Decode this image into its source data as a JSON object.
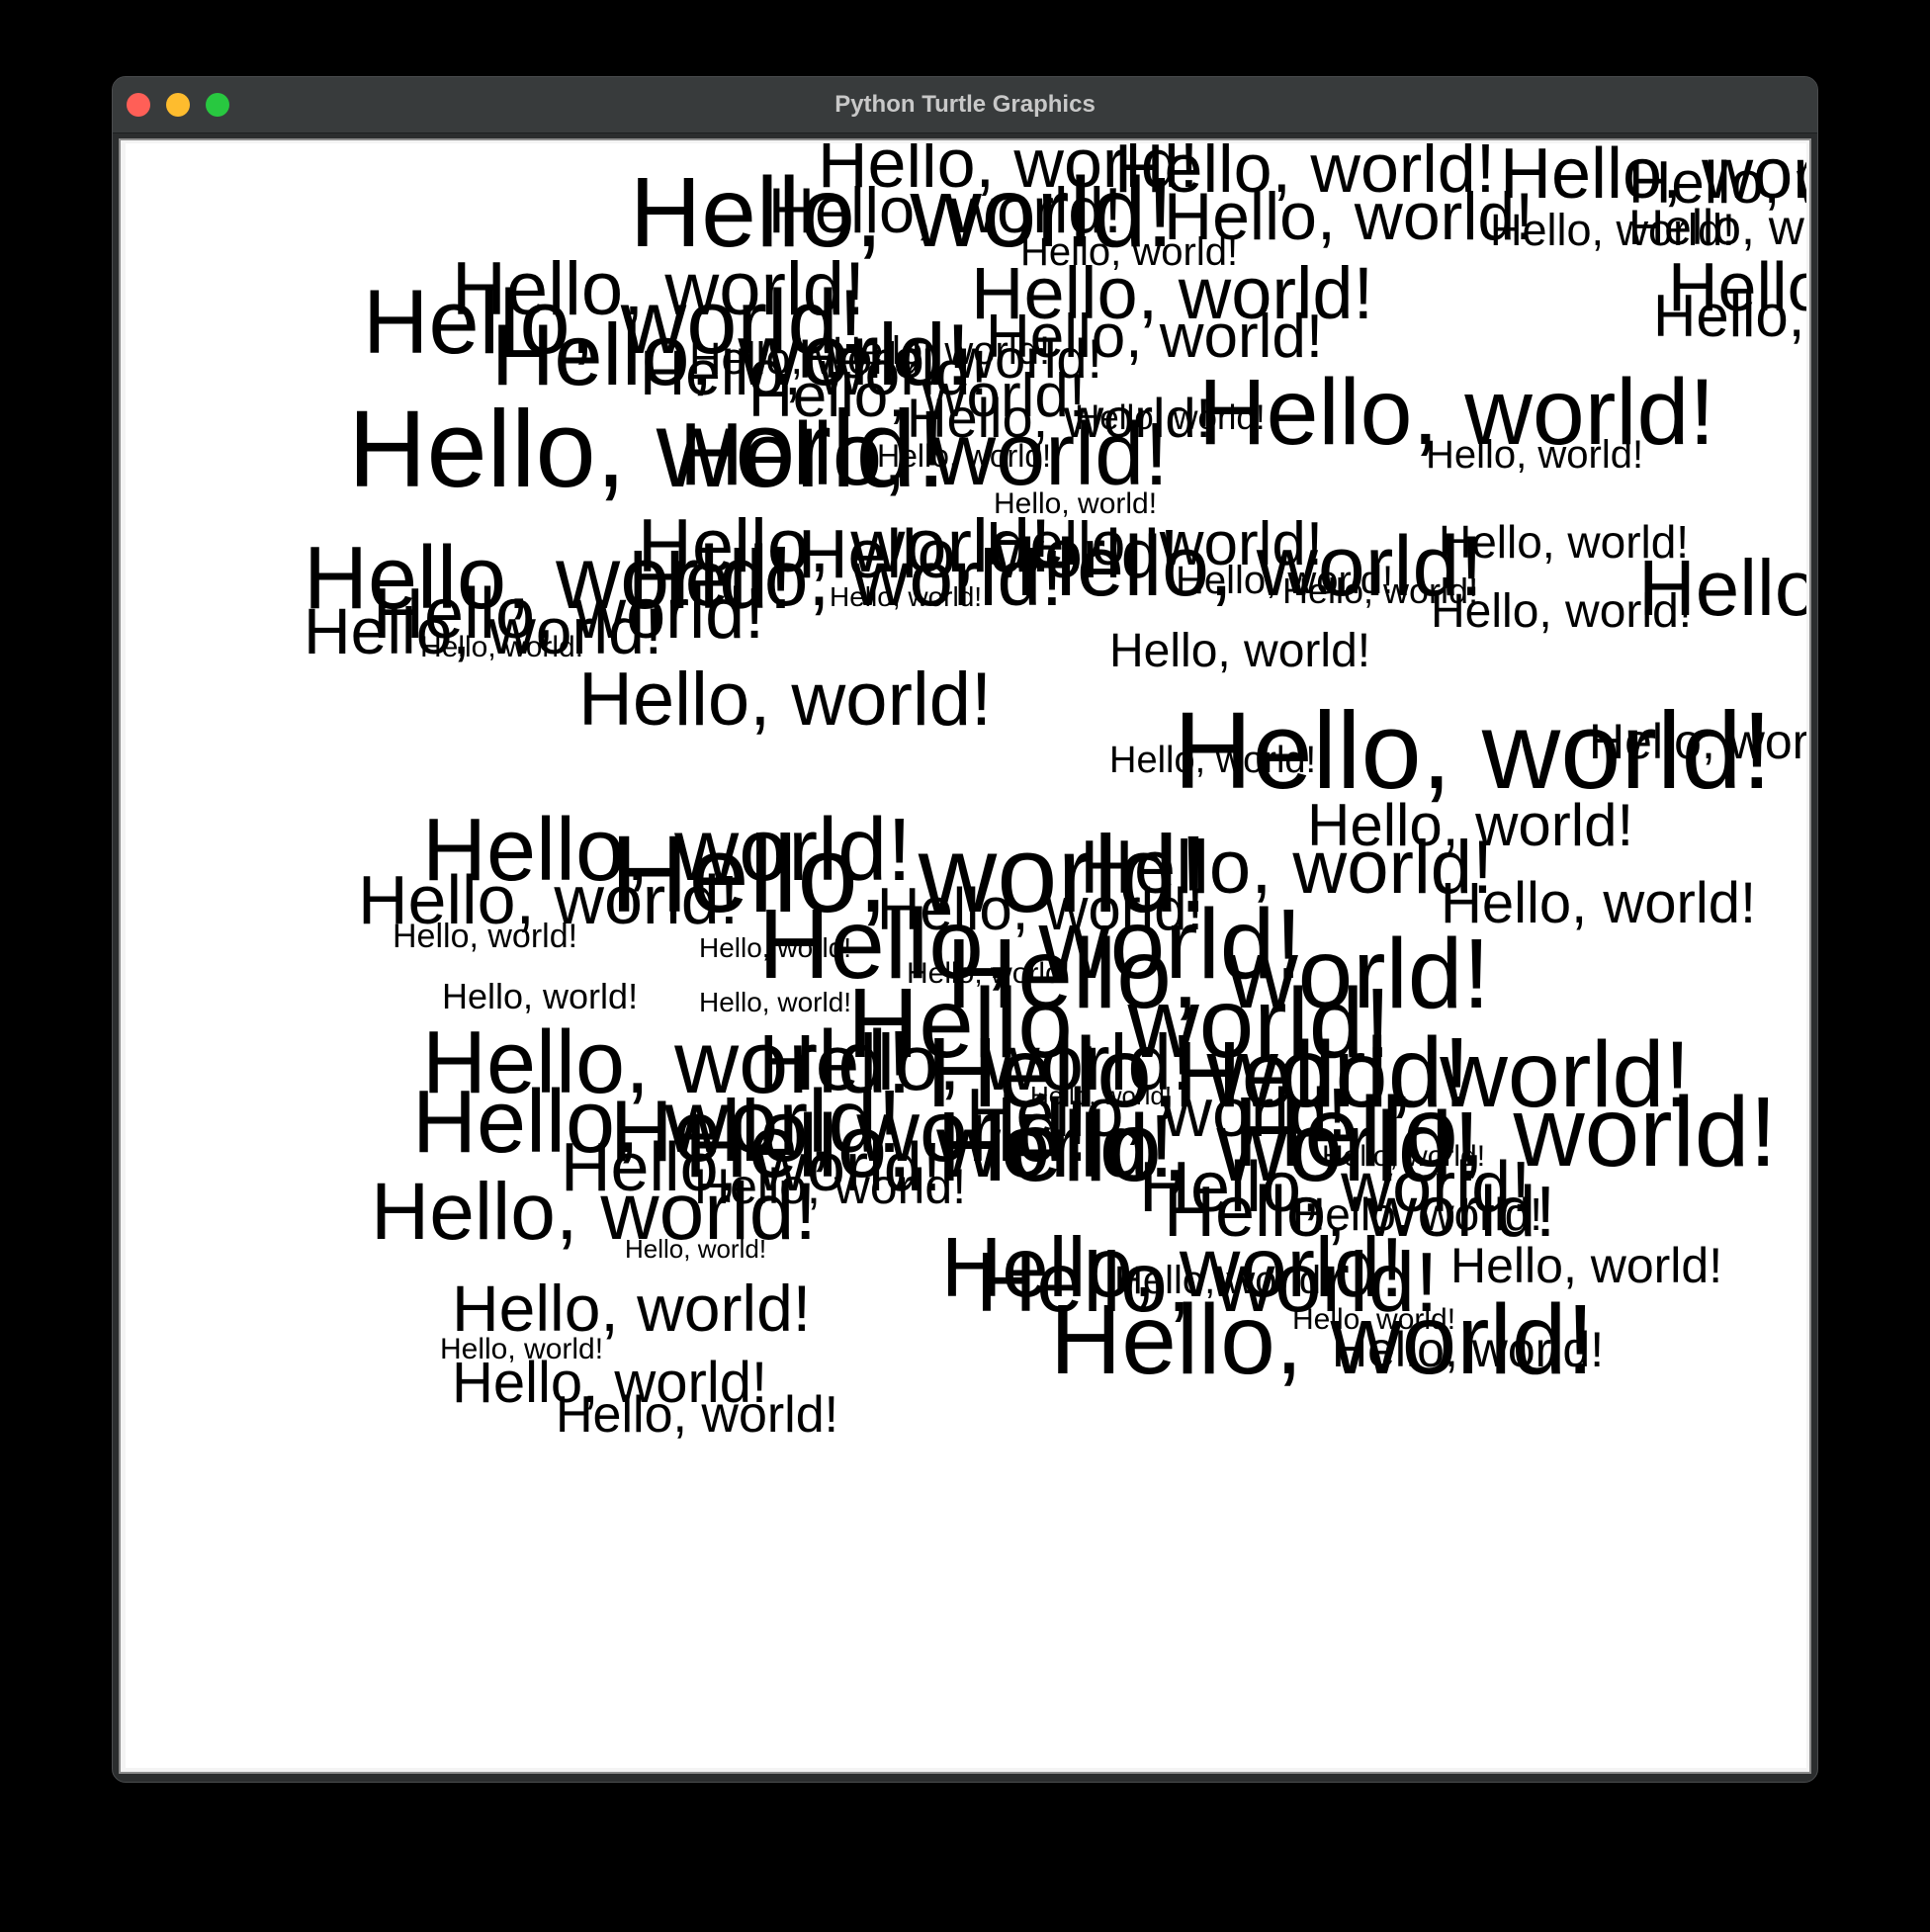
{
  "window": {
    "title": "Python Turtle Graphics"
  },
  "canvas": {
    "text": "Hello, world!",
    "text_color": "#000000",
    "background": "#ffffff"
  }
}
